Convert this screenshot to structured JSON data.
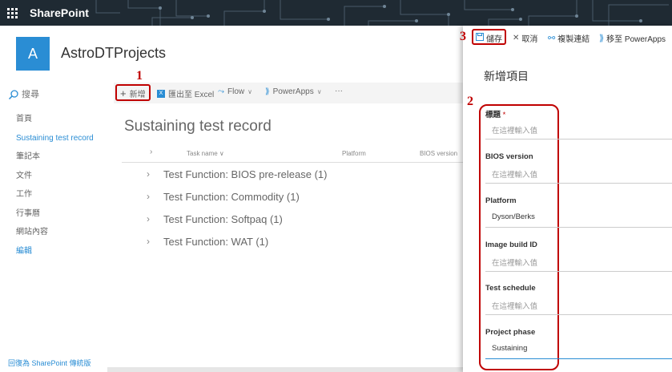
{
  "suite": {
    "app_title": "SharePoint"
  },
  "site": {
    "logo_letter": "A",
    "title": "AstroDTProjects"
  },
  "search": {
    "placeholder": "搜尋"
  },
  "nav": {
    "items": [
      {
        "label": "首頁"
      },
      {
        "label": "Sustaining test record"
      },
      {
        "label": "筆記本"
      },
      {
        "label": "文件"
      },
      {
        "label": "工作"
      },
      {
        "label": "行事曆"
      },
      {
        "label": "網站內容"
      },
      {
        "label": "編輯"
      }
    ],
    "classic_link": "回復為 SharePoint 傳統版"
  },
  "commandbar": {
    "new_label": "新增",
    "export_label": "匯出至 Excel",
    "flow_label": "Flow",
    "powerapps_label": "PowerApps",
    "more_label": "···"
  },
  "annotations": {
    "one": "1",
    "two": "2",
    "three": "3"
  },
  "list": {
    "title": "Sustaining test record",
    "columns": {
      "task_name": "Task name",
      "platform": "Platform",
      "bios_version": "BIOS version"
    },
    "groups": [
      {
        "label": "Test Function: BIOS pre-release (1)"
      },
      {
        "label": "Test Function: Commodity (1)"
      },
      {
        "label": "Test Function: Softpaq (1)"
      },
      {
        "label": "Test Function: WAT (1)"
      }
    ]
  },
  "panel": {
    "toolbar": {
      "save_label": "儲存",
      "cancel_label": "取消",
      "copy_link_label": "複製連結",
      "powerapps_label": "移至 PowerApps"
    },
    "title": "新增項目",
    "fields": [
      {
        "label": "標題",
        "required_mark": "*",
        "value": "在這裡輸入值"
      },
      {
        "label": "BIOS version",
        "value": "在這裡輸入值"
      },
      {
        "label": "Platform",
        "value": "Dyson/Berks"
      },
      {
        "label": "Image build ID",
        "value": "在這裡輸入值"
      },
      {
        "label": "Test schedule",
        "value": "在這裡輸入值"
      },
      {
        "label": "Project phase",
        "value": "Sustaining"
      }
    ]
  },
  "colors": {
    "accent": "#2a8dd4",
    "annotation": "#c00000",
    "suitebar": "#1f2a33"
  }
}
